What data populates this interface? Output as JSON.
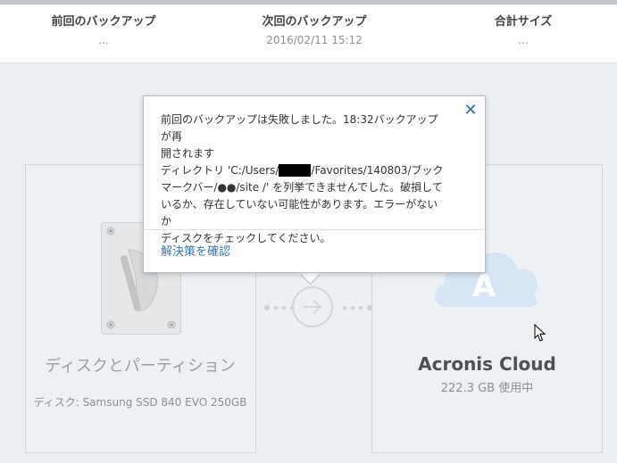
{
  "summary": {
    "last_backup_label": "前回のバックアップ",
    "last_backup_value": "...",
    "next_backup_label": "次回のバックアップ",
    "next_backup_value": "2016/02/11 15:12",
    "total_size_label": "合計サイズ",
    "total_size_value": "..."
  },
  "popup": {
    "message_line1": "前回のバックアップは失敗しました。18:32バックアップが再",
    "message_line2": "開されます",
    "message_line3a": "ディレクトリ 'C:/Users/",
    "message_line3_redacted": "■■■",
    "message_line3b": "/Favorites/140803/ブック",
    "message_line4": "マークバー/●●/site /' を列挙できませんでした。破損して",
    "message_line5": "いるか、存在していない可能性があります。エラーがないか",
    "message_line6": "ディスクをチェックしてください。",
    "link": "解決策を確認",
    "close_icon": "close-icon"
  },
  "source": {
    "title": "ディスクとパーティション",
    "subtitle": "ディスク: Samsung SSD 840 EVO 250GB"
  },
  "destination": {
    "title": "Acronis Cloud",
    "subtitle": "222.3 GB 使用中",
    "icon": "cloud-icon"
  },
  "colors": {
    "accent": "#3a75b0",
    "background": "#edf0f2",
    "card_border": "#cfd8df"
  }
}
